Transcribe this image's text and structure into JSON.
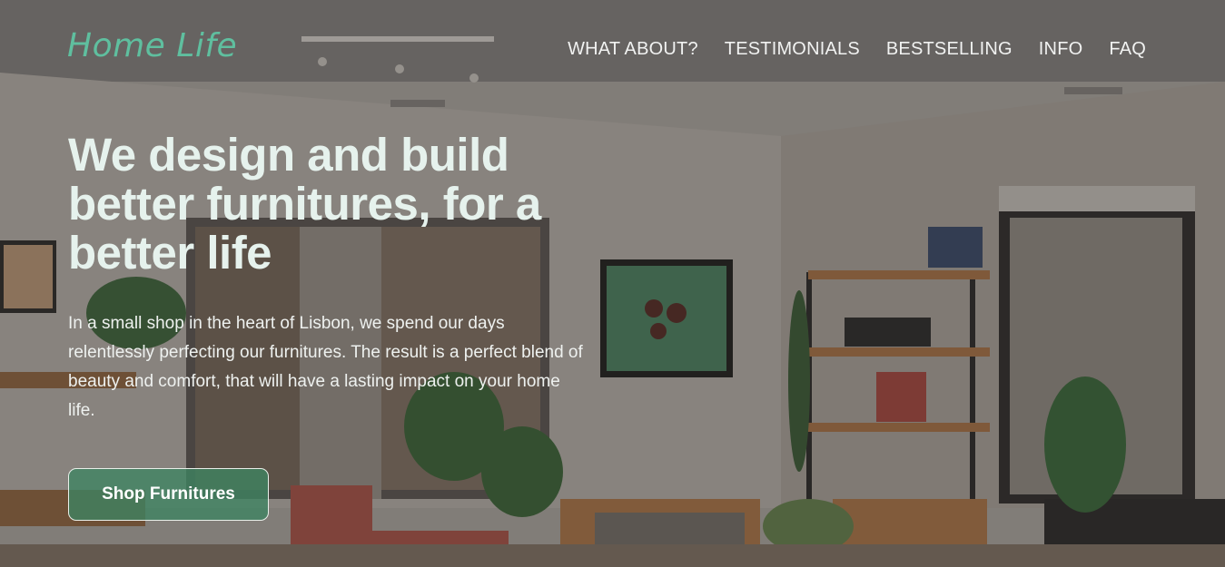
{
  "header": {
    "logo": "Home Life",
    "nav": [
      "WHAT ABOUT?",
      "TESTIMONIALS",
      "BESTSELLING",
      "INFO",
      "FAQ"
    ]
  },
  "hero": {
    "title": "We design and build better furnitures, for a better life",
    "text": "In a small shop in the heart of Lisbon, we spend our days relentlessly perfecting our furnitures. The result is a perfect blend of beauty and comfort, that will have a lasting impact on your home life.",
    "cta_label": "Shop Furnitures"
  },
  "colors": {
    "brand": "#5fbf9f",
    "cta_background": "#3e8462",
    "title_text": "#e6f2ed"
  }
}
